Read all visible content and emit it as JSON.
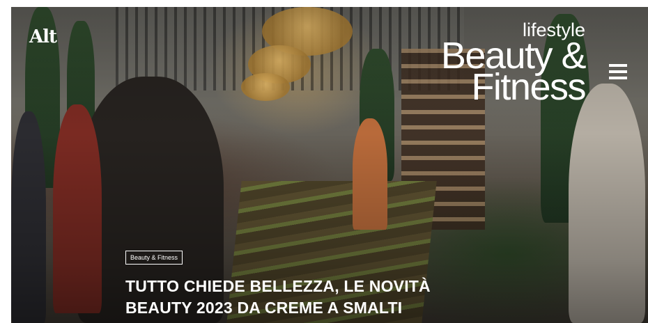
{
  "site": {
    "logo_text": "Alt"
  },
  "section": {
    "line1": "lifestyle",
    "line2": "Beauty &",
    "line3": "Fitness"
  },
  "menu": {
    "icon": "hamburger-menu-icon"
  },
  "article": {
    "category": "Beauty & Fitness",
    "title_line1": "TUTTO CHIEDE BELLEZZA, LE NOVITÀ",
    "title_line2": "BEAUTY 2023 DA CREME A SMALTI"
  }
}
